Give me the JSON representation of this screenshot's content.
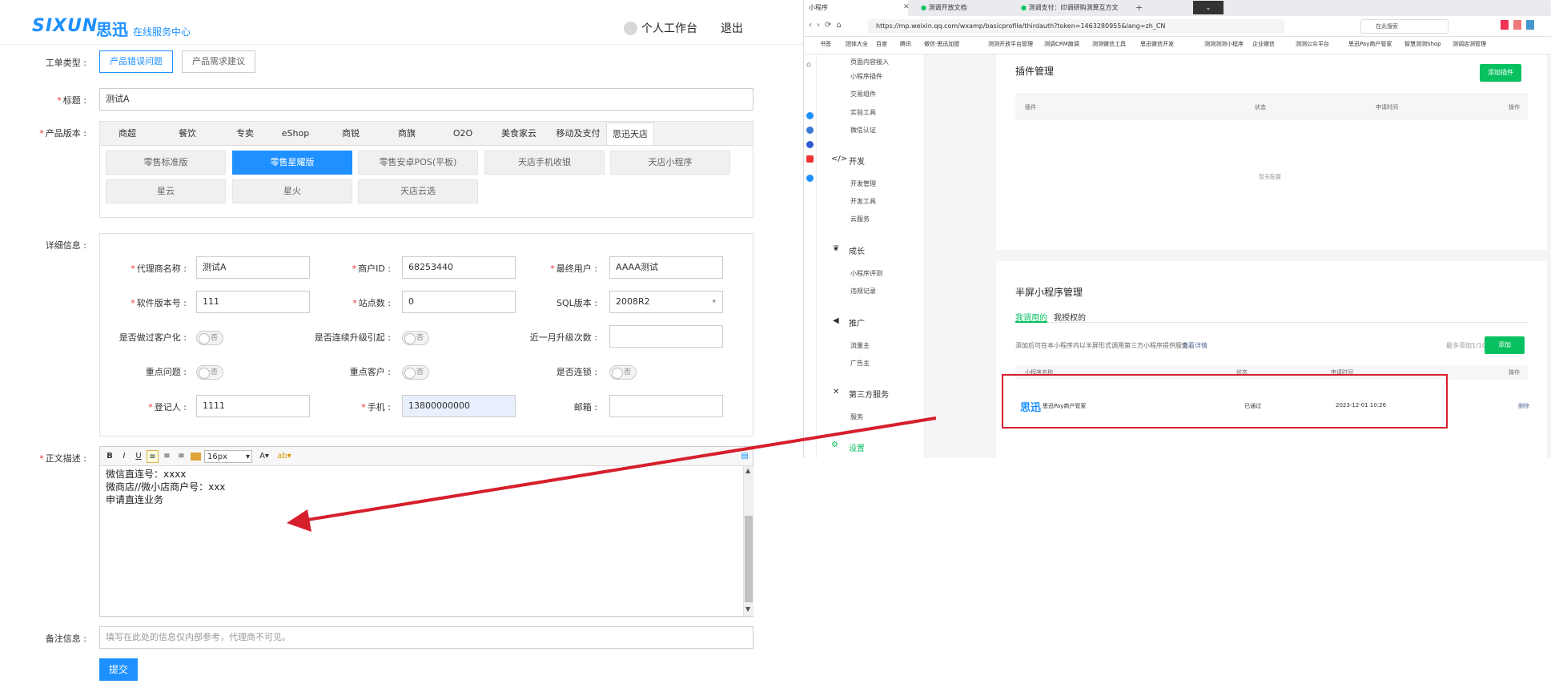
{
  "header": {
    "logo_en": "SIXUN",
    "logo_cn": "思迅",
    "logo_sub": "在线服务中心",
    "workbench": "个人工作台",
    "logout": "退出"
  },
  "form": {
    "ticket_type_label": "工单类型 :",
    "ticket_types": [
      "产品错误问题",
      "产品需求建议"
    ],
    "title_label": "标题 :",
    "title_value": "测试A",
    "product_label": "产品版本 :",
    "product_tabs": [
      "商超",
      "餐饮",
      "专卖",
      "eShop",
      "商锐",
      "商旗",
      "O2O",
      "美食家云",
      "移动及支付",
      "思迅天店"
    ],
    "versions": [
      "零售标准版",
      "零售星耀版",
      "零售安卓POS(平板)",
      "天店手机收银",
      "天店小程序",
      "星云",
      "星火",
      "天店云选"
    ],
    "detail_label": "详细信息 :",
    "agent_label": "代理商名称 :",
    "agent_value": "测试A",
    "merchant_label": "商户ID :",
    "merchant_value": "68253440",
    "enduser_label": "最终用户 :",
    "enduser_value": "AAAA测试",
    "softver_label": "软件版本号 :",
    "softver_value": "111",
    "sites_label": "站点数 :",
    "sites_value": "0",
    "sql_label": "SQL版本 :",
    "sql_value": "2008R2",
    "custom_label": "是否做过客户化 :",
    "upgrade_label": "是否连续升级引起 :",
    "upgrades_month_label": "近一月升级次数 :",
    "key_issue_label": "重点问题 :",
    "key_customer_label": "重点客户 :",
    "chain_label": "是否连锁 :",
    "toggle_no": "否",
    "registrant_label": "登记人 :",
    "registrant_value": "1111",
    "phone_label": "手机 :",
    "phone_value": "13800000000",
    "email_label": "邮箱 :",
    "body_label": "正文描述 :",
    "toolbar": {
      "bold": "B",
      "italic": "I",
      "underline": "U",
      "font_size": "16px",
      "font_color": "A",
      "highlight": "ab"
    },
    "body_lines": [
      "微信直连号：xxxx",
      "微商店//微小店商户号：xxx",
      "申请直连业务"
    ],
    "remark_label": "备注信息 :",
    "remark_placeholder": "填写在此处的信息仅内部参考，代理商不可见。",
    "submit": "提交"
  },
  "browser": {
    "tabs": [
      "小程序",
      "测调开放文档",
      "测调支付：印调研购测算互方文"
    ],
    "url": "https://mp.weixin.qq.com/wxamp/basicprofile/thirdauth?token=1463280955&lang=zh_CN",
    "search_placeholder": "在此搜索",
    "bookmarks": [
      "书签",
      "团体大全",
      "百度",
      "腾讯",
      "微信·思迅加盟",
      "测测开放平台管理",
      "测调CRM旗调",
      "测测微信工具",
      "思迅微信开发",
      "测测测测小程序",
      "企业微信",
      "测测公众平台",
      "思迅Pay商户管家",
      "智慧测测Shop",
      "测调店测管理"
    ]
  },
  "sidebar": {
    "items_top": [
      "页面内容接入",
      "小程序插件",
      "交易组件",
      "实验工具",
      "微信认证"
    ],
    "dev_head": "开发",
    "dev_items": [
      "开发管理",
      "开发工具",
      "云服务"
    ],
    "growth_head": "成长",
    "growth_items": [
      "小程序评测",
      "违规记录"
    ],
    "promo_head": "推广",
    "promo_items": [
      "流量主",
      "广告主"
    ],
    "third_head": "第三方服务",
    "third_items": [
      "服务"
    ],
    "settings": "设置"
  },
  "plugins": {
    "title": "插件管理",
    "add": "添加插件",
    "cols": [
      "插件",
      "状态",
      "申请时间",
      "操作"
    ],
    "empty": "暂无配置"
  },
  "halfscreen": {
    "title": "半屏小程序管理",
    "tabs": [
      "我调用的",
      "我授权的"
    ],
    "desc": "添加后可在本小程序内以半屏形式调用第三方小程序提供服务。",
    "desc_link": "查看详情",
    "quota": "最多添加1/10",
    "add": "添加",
    "cols": [
      "小程序名称",
      "状态",
      "申请时间",
      "操作"
    ],
    "row": {
      "logo": "思迅",
      "name": "思迅Pay商户管家",
      "status": "已通过",
      "time": "2023-12-01 10:26",
      "action": "删除"
    }
  },
  "colors": {
    "accent": "#1e90ff",
    "wechat_green": "#07c160",
    "annotation_red": "#d61f2c"
  }
}
